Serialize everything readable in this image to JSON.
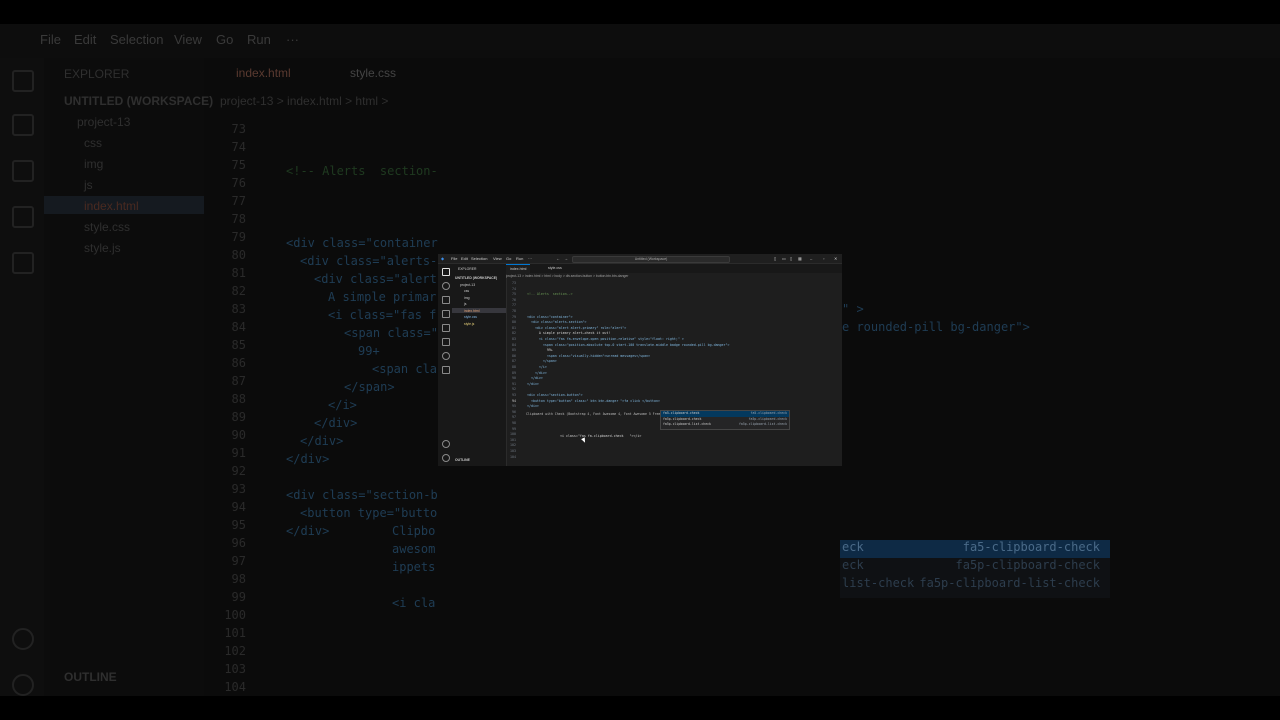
{
  "background_window": {
    "menu": [
      "File",
      "Edit",
      "Selection",
      "View",
      "Go",
      "Run",
      "···"
    ],
    "explorer_title": "EXPLORER",
    "workspace": "UNTITLED (WORKSPACE)",
    "tree": [
      {
        "label": "project-13",
        "kind": "folder"
      },
      {
        "label": "css",
        "kind": "folder"
      },
      {
        "label": "img",
        "kind": "folder"
      },
      {
        "label": "js",
        "kind": "folder"
      },
      {
        "label": "index.html",
        "kind": "file",
        "selected": true
      },
      {
        "label": "style.css",
        "kind": "file"
      },
      {
        "label": "style.js",
        "kind": "file"
      }
    ],
    "outline": "OUTLINE",
    "tabs": [
      "index.html",
      "style.css"
    ],
    "breadcrumb": "project-13 > index.html > html >",
    "line_numbers": [
      "73",
      "74",
      "75",
      "76",
      "77",
      "78",
      "79",
      "80",
      "81",
      "82",
      "83",
      "84",
      "85",
      "86",
      "87",
      "88",
      "89",
      "90",
      "91",
      "92",
      "93",
      "94",
      "95",
      "96",
      "97",
      "98",
      "99",
      "100",
      "101",
      "102",
      "103",
      "104"
    ],
    "code_fragments": [
      "<!-- Alerts  section-",
      "<div class=\"container",
      "<div class=\"alerts-",
      "<div class=\"alert",
      "A simple primar",
      "<i class=\"fas f",
      "<span class=\"",
      "99+",
      "<span class",
      "</span>",
      "</i>",
      "</div>",
      "</div>",
      "</div>",
      "<div class=\"section-b",
      "<button type=\"butto",
      "</div>",
      "Clipbo",
      "awesom",
      "ippets",
      "<i cla"
    ],
    "right_fragments": [
      "\" >",
      "e rounded-pill bg-danger\">"
    ],
    "suggestions": [
      {
        "left": "eck",
        "right": "fa5-clipboard-check"
      },
      {
        "left": "eck",
        "right": "fa5p-clipboard-check"
      },
      {
        "left": "list-check",
        "right": "fa5p-clipboard-list-check"
      }
    ]
  },
  "window": {
    "menu": [
      "File",
      "Edit",
      "Selection",
      "View",
      "Go",
      "Run",
      "···"
    ],
    "search": "Untitled (Workspace)",
    "explorer_title": "EXPLORER",
    "workspace": "UNTITLED (WORKSPACE)",
    "tree": [
      "project-13",
      "css",
      "img",
      "js",
      "index.html",
      "style.css",
      "style.js"
    ],
    "outline": "OUTLINE",
    "tabs": [
      "index.html",
      "style.css"
    ],
    "breadcrumb": "project-13 > index.html > html > body > div.section-button > button.btn.btn-danger",
    "line_numbers": [
      "73",
      "74",
      "75",
      "76",
      "77",
      "78",
      "79",
      "80",
      "81",
      "82",
      "83",
      "84",
      "85",
      "86",
      "87",
      "88",
      "89",
      "90",
      "91",
      "92",
      "93",
      "94",
      "95",
      "96",
      "97",
      "98",
      "99",
      "100",
      "101",
      "102",
      "103",
      "104"
    ],
    "code": [
      "",
      "",
      "<!-- Alerts  section-->",
      "",
      "",
      "",
      "<div class=\"container\">",
      "  <div class=\"alerts-section\">",
      "    <div class=\"alert alert-primary\" role=\"alert\">",
      "      A simple primary alert—check it out!",
      "      <i class=\"fas fa-envelope-open position-relative\" style=\"float: right;\" >",
      "        <span class=\"position-absolute top-0 start-100 translate-middle badge rounded-pill bg-danger\">",
      "          99+",
      "          <span class=\"visually-hidden\">unread messages</span>",
      "        </span>",
      "      </i>",
      "    </div>",
      "  </div>",
      "</div>",
      "",
      "<div class=\"section-button\">",
      "  <button type=\"button\" class=\" btn btn-danger \">fa click </button>",
      "</div>",
      "",
      "",
      "",
      "",
      "",
      "",
      "",
      "",
      ""
    ],
    "hint_text": "Clipboard with Check (Bootstrap 4, Font Awesome 4, Font Awesome 5 Free & Pro sn ippets)",
    "hint_snippet": "<i class=\"fas fa-clipboard-check   \"></i>",
    "suggestions": [
      {
        "label": "fa5-clipboard-check",
        "detail": "fa5-clipboard-check"
      },
      {
        "label": "fa5p-clipboard-check",
        "detail": "fa5p-clipboard-check"
      },
      {
        "label": "fa5p-clipboard-list-check",
        "detail": "fa5p-clipboard-list-check"
      }
    ]
  }
}
